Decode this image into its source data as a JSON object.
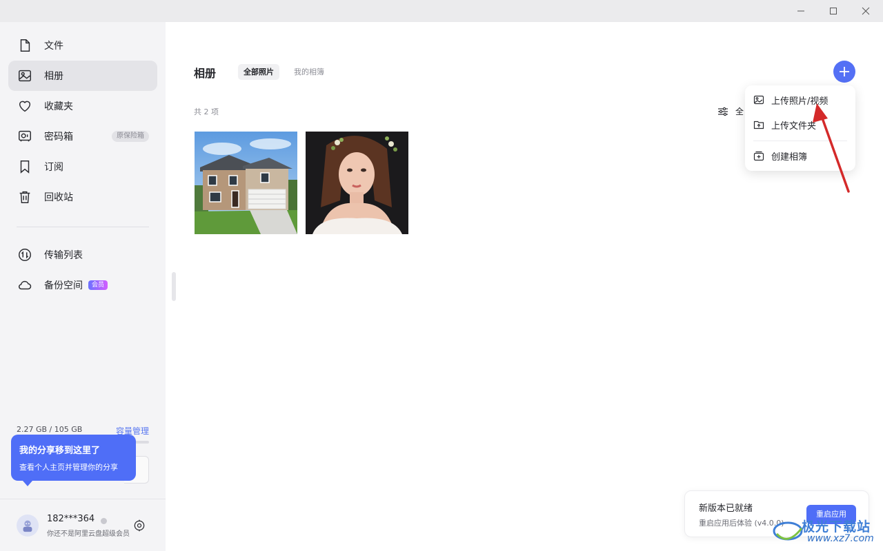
{
  "window": {
    "controls": [
      "minimize",
      "maximize",
      "close"
    ]
  },
  "sidebar": {
    "items": [
      {
        "label": "文件",
        "icon": "file-icon"
      },
      {
        "label": "相册",
        "icon": "photo-album-icon",
        "active": true
      },
      {
        "label": "收藏夹",
        "icon": "heart-icon"
      },
      {
        "label": "密码箱",
        "icon": "safe-box-icon",
        "badge": "原保险箱"
      },
      {
        "label": "订阅",
        "icon": "bookmark-icon"
      },
      {
        "label": "回收站",
        "icon": "trash-icon"
      },
      {
        "label": "传输列表",
        "icon": "transfer-icon"
      },
      {
        "label": "备份空间",
        "icon": "cloud-icon",
        "badge": "会员"
      }
    ],
    "storage": {
      "used_text": "2.27 GB / 105 GB",
      "manage_label": "容量管理",
      "used_fraction": 0.0216
    },
    "tooltip": {
      "title": "我的分享移到这里了",
      "desc": "查看个人主页并管理你的分享"
    },
    "user": {
      "name": "182***364",
      "subtitle": "你还不是阿里云盘超级会员"
    }
  },
  "main": {
    "title": "相册",
    "tabs": [
      {
        "label": "全部照片",
        "active": true
      },
      {
        "label": "我的相簿",
        "active": false
      }
    ],
    "count_text": "共 2 项",
    "filter_label": "全",
    "photos": [
      {
        "name": "house-photo"
      },
      {
        "name": "woman-portrait-photo"
      }
    ]
  },
  "dropdown": {
    "items": [
      {
        "label": "上传照片/视频",
        "icon": "image-upload-icon"
      },
      {
        "label": "上传文件夹",
        "icon": "folder-upload-icon"
      },
      {
        "label": "创建相簿",
        "icon": "create-album-icon"
      }
    ]
  },
  "toast": {
    "title": "新版本已就绪",
    "subtitle": "重启应用后体验 (v4.0.0)",
    "button_label": "重启应用"
  },
  "watermark": {
    "text_cn": "极光下载站",
    "text_url": "www.xz7.com"
  },
  "colors": {
    "accent": "#5470f5",
    "sidebar_bg": "#f4f4f6",
    "active_bg": "#e4e4e8",
    "arrow": "#d42a2a"
  }
}
